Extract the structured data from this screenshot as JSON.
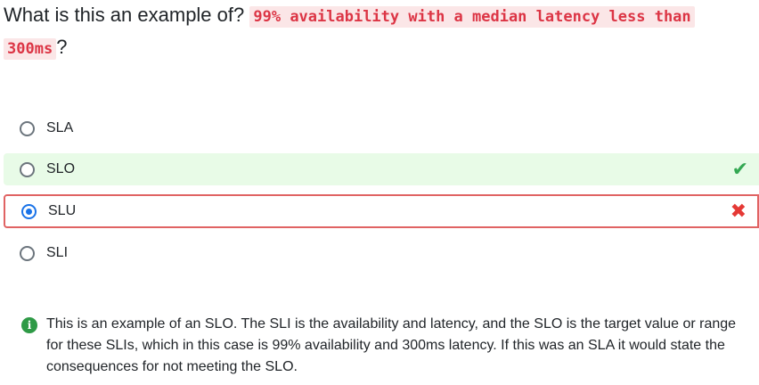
{
  "question": {
    "prefix": "What is this an example of?",
    "code_line1": "99% availability with a median latency less than",
    "code_line2": "300ms",
    "suffix": "?"
  },
  "options": [
    {
      "label": "SLA",
      "selected": false,
      "status": "none"
    },
    {
      "label": "SLO",
      "selected": false,
      "status": "correct"
    },
    {
      "label": "SLU",
      "selected": true,
      "status": "wrong"
    },
    {
      "label": "SLI",
      "selected": false,
      "status": "none"
    }
  ],
  "explanation": {
    "icon": "info-icon",
    "text": "This is an example of an SLO. The SLI is the availability and latency, and the SLO is the target value or range for these SLIs, which in this case is 99% availability and 300ms latency. If this was an SLA it would state the consequences for not meeting the SLO."
  },
  "colors": {
    "correct_bg": "#e8fbe7",
    "correct_icon": "#34a853",
    "wrong_border": "#e06363",
    "wrong_icon": "#e53935",
    "code_text": "#dc3545",
    "code_bg": "#fbe6e7",
    "radio_selected": "#1a73e8",
    "info_icon": "#2e9a46"
  }
}
